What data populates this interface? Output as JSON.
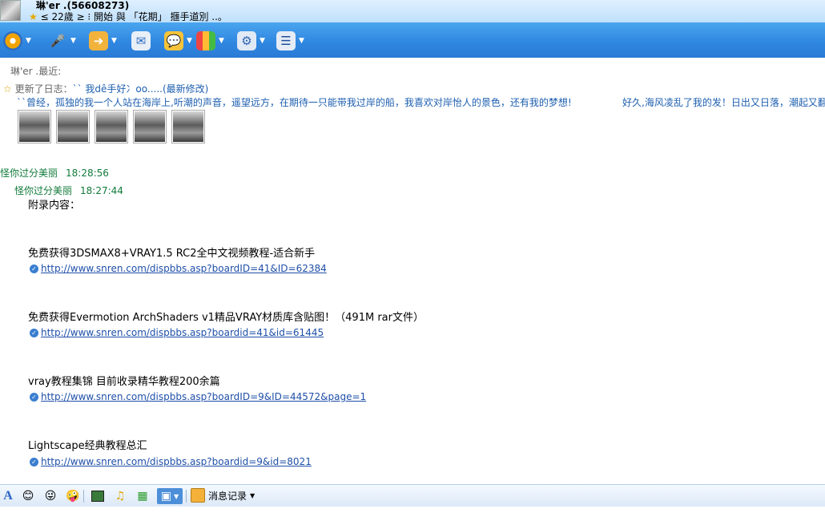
{
  "header": {
    "name": "琳'er .(56608273)",
    "signature": "≤ 22歲 ≥ ⁝ 開始 與 「花期」 擓手道別 ..。"
  },
  "toolbar": {
    "items": [
      {
        "icon": "video-icon",
        "dropdown": true
      },
      {
        "icon": "microphone-icon",
        "dropdown": true
      },
      {
        "icon": "folder-transfer-icon",
        "dropdown": true
      },
      {
        "icon": "email-icon",
        "dropdown": false
      },
      {
        "icon": "chat-bubble-icon",
        "dropdown": true
      },
      {
        "icon": "apps-icon",
        "dropdown": true
      },
      {
        "icon": "settings-icon",
        "dropdown": true
      },
      {
        "icon": "profile-icon",
        "dropdown": true
      }
    ]
  },
  "recent": {
    "label": "琳'er .最近:"
  },
  "diary": {
    "prefix": "更新了日志：",
    "title": "`` 我dê手好冫oo.....(最新修改)",
    "excerpt1": "``曾经，孤独的我一个人站在海岸上,听潮的声音，遥望远方，在期待一只能带我过岸的船，我喜欢对岸怡人的景色，还有我的梦想!",
    "excerpt2": "好久,海风凌乱了我的发！日出又日落，潮起又翻"
  },
  "messages": [
    {
      "sender": "怪你过分美丽",
      "time": "18:28:56"
    },
    {
      "sender": "怪你过分美丽",
      "time": "18:27:44"
    }
  ],
  "appendix": {
    "heading": "附录内容：",
    "entries": [
      {
        "title": "免费获得3DSMAX8+VRAY1.5 RC2全中文视频教程-适合新手",
        "url": "http://www.snren.com/dispbbs.asp?boardID=41&ID=62384"
      },
      {
        "title": "免费获得Evermotion ArchShaders v1精品VRAY材质库含贴图！（491M rar文件）",
        "url": "http://www.snren.com/dispbbs.asp?boardid=41&id=61445"
      },
      {
        "title": "vray教程集锦 目前收录精华教程200余篇",
        "url": "http://www.snren.com/dispbbs.asp?boardID=9&ID=44572&page=1"
      },
      {
        "title": "Lightscape经典教程总汇",
        "url": "http://www.snren.com/dispbbs.asp?boardid=9&id=8021"
      }
    ]
  },
  "bottombar": {
    "font_label": "A",
    "history_label": "消息记录"
  }
}
